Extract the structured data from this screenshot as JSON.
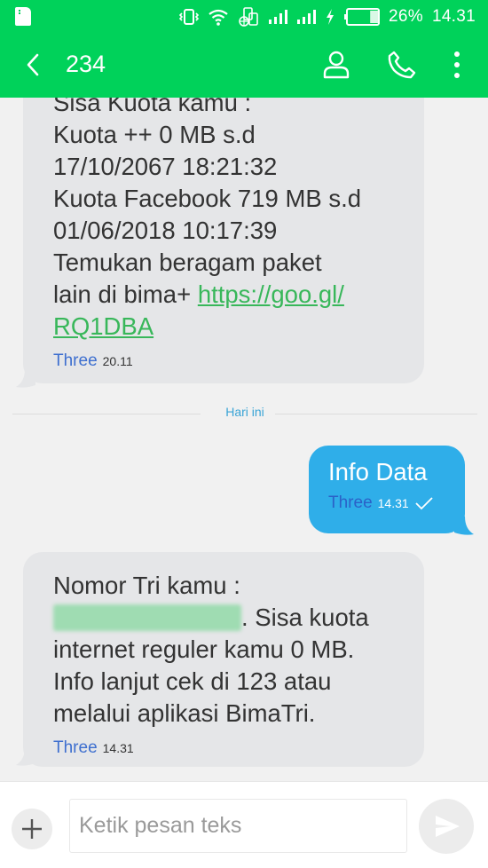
{
  "status_bar": {
    "battery_percent": "26%",
    "battery_level": 0.26,
    "time": "14.31",
    "icons": [
      "sd-card-icon",
      "vibrate-icon",
      "wifi-icon",
      "dual-sim-icon",
      "signal-sim1-icon",
      "signal-sim2-icon",
      "charging-icon",
      "battery-icon"
    ]
  },
  "header": {
    "title": "234",
    "back_icon": "chevron-left-icon",
    "contact_icon": "person-icon",
    "call_icon": "phone-icon",
    "more_icon": "more-vertical-icon"
  },
  "colors": {
    "header": "#00d25a",
    "incoming_bubble": "#e5e6e8",
    "outgoing_bubble": "#2faee9",
    "link": "#38b75a",
    "sim_label": "#3e6fcf",
    "divider_label": "#3aa4d6"
  },
  "messages": [
    {
      "direction": "incoming",
      "lines": [
        "Sisa Kuota kamu :",
        "Kuota ++ 0 MB s.d",
        "17/10/2067 18:21:32",
        "Kuota Facebook 719 MB s.d",
        "01/06/2018 10:17:39",
        "Temukan beragam paket",
        "lain di bima+ "
      ],
      "link_part1": "https://goo.gl/",
      "link_part2": "RQ1DBA",
      "sim": "Three",
      "time": "20.11"
    },
    {
      "direction": "outgoing",
      "text": "Info Data",
      "sim": "Three",
      "time": "14.31",
      "status_icon": "check-icon"
    },
    {
      "direction": "incoming",
      "line1": "Nomor Tri kamu :",
      "line2_after_redacted": ". Sisa kuota",
      "line3": "internet reguler kamu 0 MB.",
      "line4": "Info lanjut cek di 123 atau",
      "line5": "melalui aplikasi BimaTri.",
      "sim": "Three",
      "time": "14.31"
    }
  ],
  "date_divider": "Hari ini",
  "composer": {
    "placeholder": "Ketik pesan teks",
    "value": "",
    "add_icon": "plus-icon",
    "send_icon": "send-icon"
  }
}
